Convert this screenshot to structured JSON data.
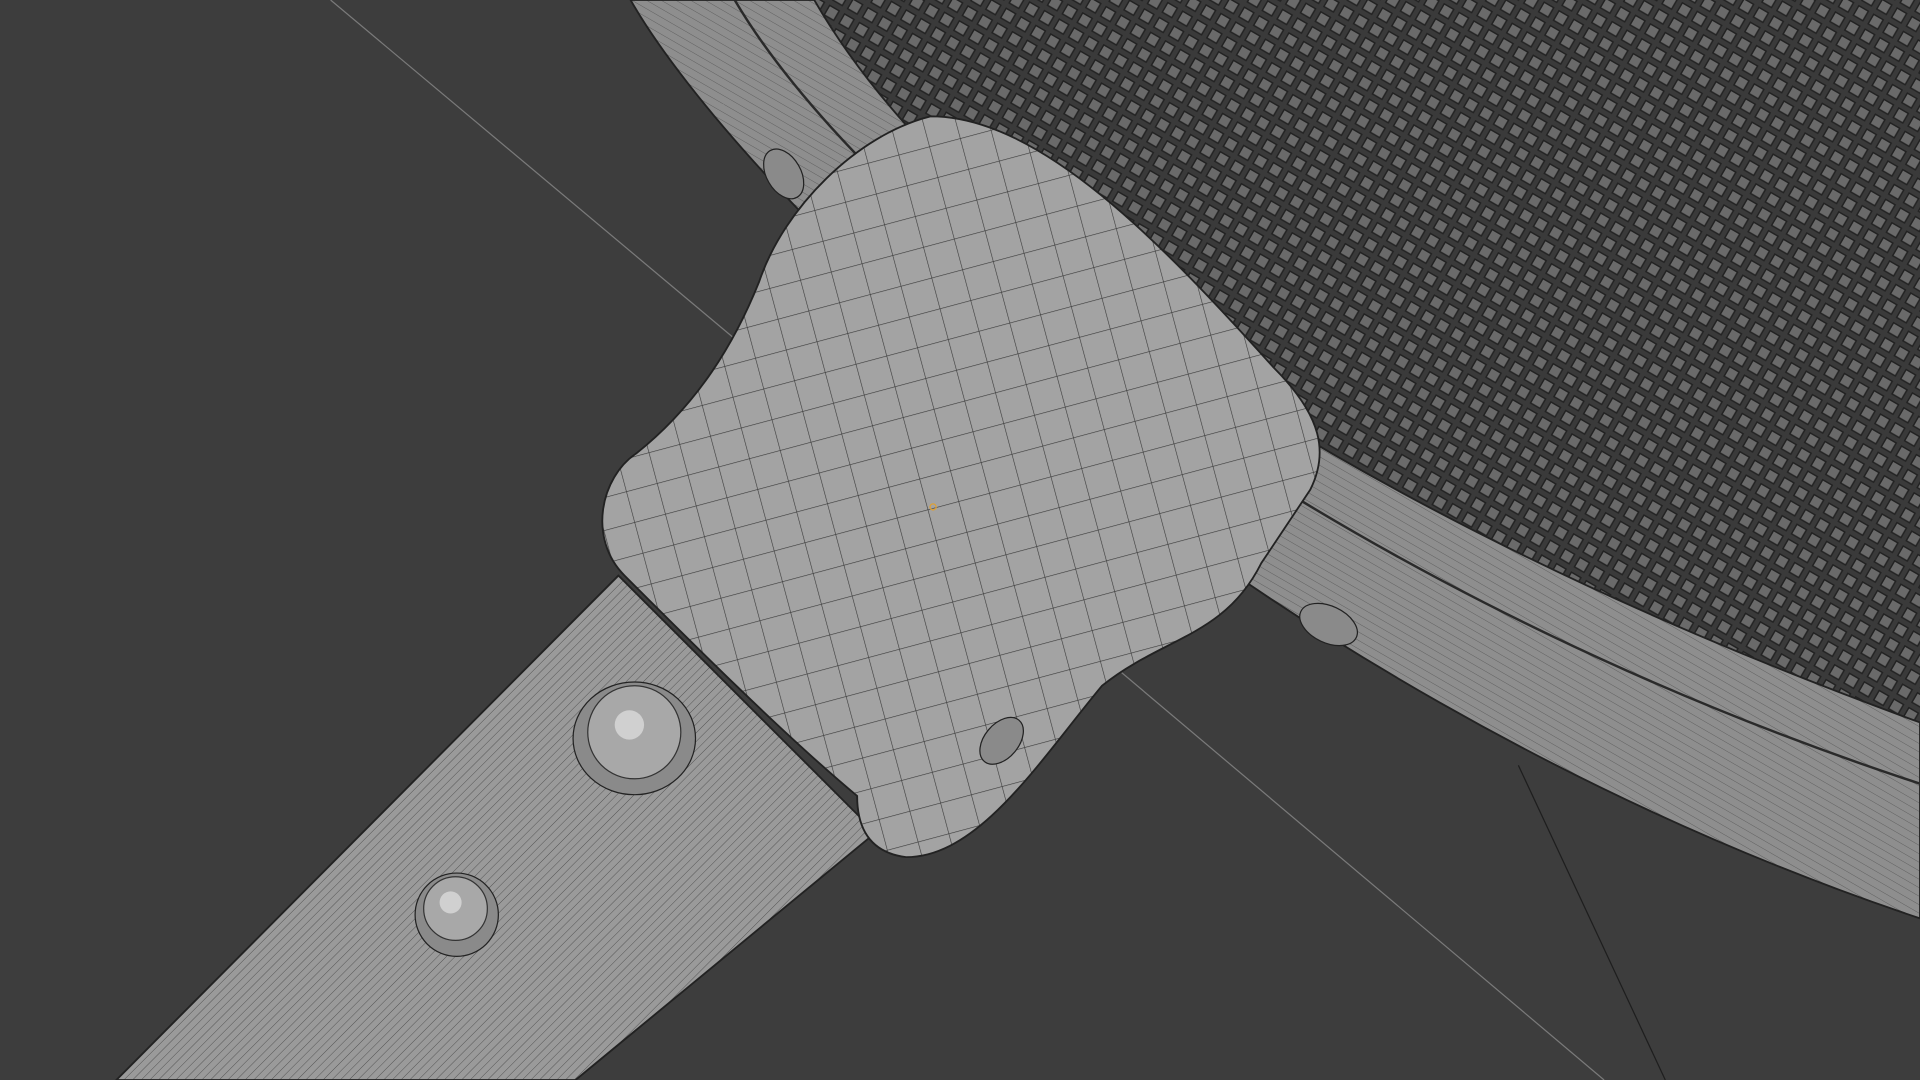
{
  "viewport": {
    "mode": "wireframe-overlay",
    "background": "#3d3d3d",
    "model_color": "#9c9c9c",
    "mesh_color": "#2e2e2e"
  }
}
